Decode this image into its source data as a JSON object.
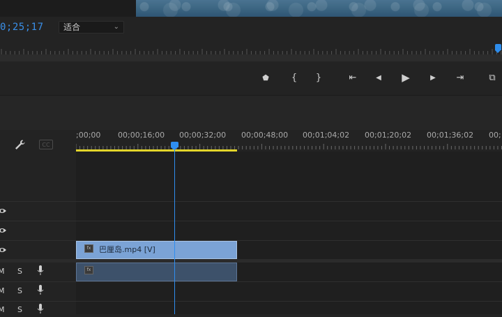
{
  "monitor": {
    "timecode": "0;25;17",
    "fit_select": "适合"
  },
  "transport": [
    {
      "name": "add-marker-button",
      "glyph": "⬟"
    },
    {
      "name": "mark-in-button",
      "glyph": "{"
    },
    {
      "name": "mark-out-button",
      "glyph": "}"
    },
    {
      "name": "go-to-in-button",
      "glyph": "⇤"
    },
    {
      "name": "step-back-button",
      "glyph": "◀"
    },
    {
      "name": "play-button",
      "glyph": "▶"
    },
    {
      "name": "step-forward-button",
      "glyph": "▶"
    },
    {
      "name": "go-to-out-button",
      "glyph": "⇥"
    },
    {
      "name": "export-frame-button",
      "glyph": "⧉"
    }
  ],
  "timeline": {
    "ruler_labels": [
      ";00;00",
      "00;00;16;00",
      "00;00;32;00",
      "00;00;48;00",
      "00;01;04;02",
      "00;01;20;02",
      "00;01;36;02",
      "00;"
    ],
    "video_clip_name": "巴厘岛.mp4 [V]",
    "audio_tracks": [
      {
        "m": "M",
        "s": "S"
      },
      {
        "m": "M",
        "s": "S"
      },
      {
        "m": "M",
        "s": "S"
      }
    ]
  },
  "icons": {
    "wrench": "wrench-icon",
    "captions": "cc-icon",
    "eye": "eye-icon",
    "mic": "microphone-icon"
  },
  "colors": {
    "accent": "#2f8ef0",
    "work_area": "#e3d52a",
    "video_clip": "#7ba3d6",
    "audio_clip": "#3d516a"
  }
}
